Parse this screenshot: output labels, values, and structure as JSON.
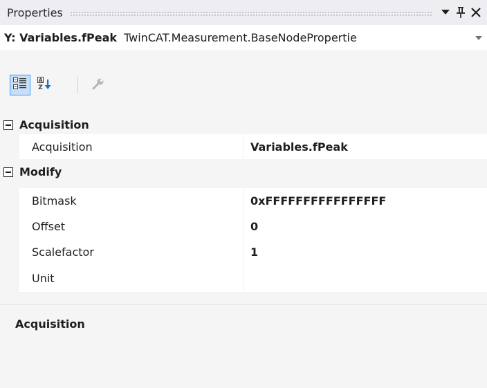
{
  "panel": {
    "title": "Properties",
    "buttons": {
      "dropdown_icon": "chevron-down",
      "pin_icon": "pin",
      "close_icon": "close"
    }
  },
  "object_selector": {
    "name": "Y: Variables.fPeak",
    "type": "TwinCAT.Measurement.BaseNodePropertie",
    "dropdown_icon": "chevron-down"
  },
  "toolbar": {
    "buttons": [
      {
        "icon": "categorized",
        "active": true
      },
      {
        "icon": "alphabetical",
        "active": false
      },
      {
        "icon": "property-pages",
        "active": false
      }
    ]
  },
  "categories": [
    {
      "label": "Acquisition",
      "expander": "−",
      "properties": [
        {
          "name": "Acquisition",
          "value": "Variables.fPeak"
        }
      ]
    },
    {
      "label": "Modify",
      "expander": "−",
      "properties": [
        {
          "name": "Bitmask",
          "value": "0xFFFFFFFFFFFFFFFF"
        },
        {
          "name": "Offset",
          "value": "0"
        },
        {
          "name": "Scalefactor",
          "value": "1"
        },
        {
          "name": "Unit",
          "value": ""
        }
      ]
    }
  ],
  "description": {
    "title": "Acquisition",
    "text": ""
  },
  "colors": {
    "background": "#f5f5f5",
    "accent": "#3399ff",
    "text": "#1e1e1e"
  }
}
